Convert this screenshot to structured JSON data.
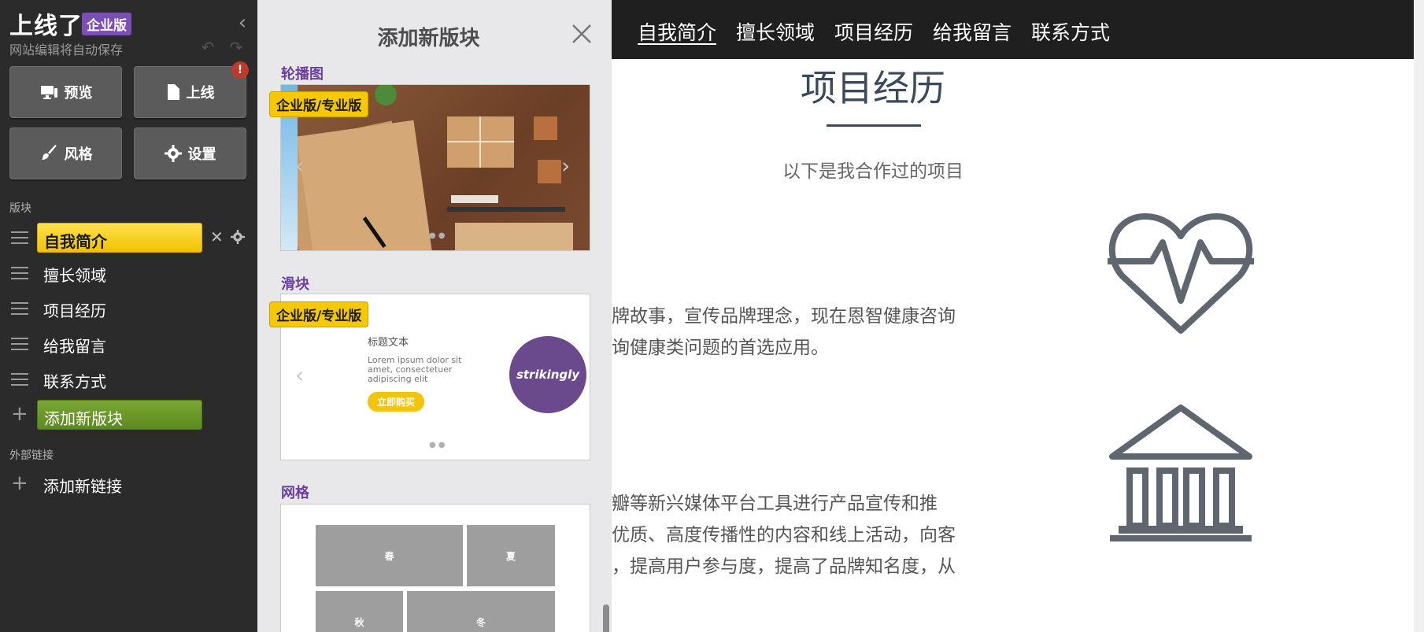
{
  "sidebar": {
    "brand": "上线了",
    "edition_badge": "企业版",
    "autosave_note": "网站编辑将自动保存",
    "alert_count": "!",
    "buttons": {
      "preview": "预览",
      "publish": "上线",
      "style": "风格",
      "settings": "设置"
    },
    "section_blocks": "版块",
    "items": [
      {
        "label": "自我简介",
        "active": true
      },
      {
        "label": "擅长领域"
      },
      {
        "label": "项目经历"
      },
      {
        "label": "给我留言"
      },
      {
        "label": "联系方式"
      }
    ],
    "add_block": "添加新版块",
    "section_links": "外部链接",
    "add_link": "添加新链接",
    "colors": {
      "bg": "#2b2b2b",
      "active": "#f5c800",
      "add": "#6a9a27"
    }
  },
  "panel": {
    "title": "添加新版块",
    "categories": [
      {
        "label": "轮播图",
        "tier": "企业版/专业版"
      },
      {
        "label": "滑块",
        "tier": "企业版/专业版"
      },
      {
        "label": "网格"
      }
    ],
    "slider_preview": {
      "heading": "标题文本",
      "body": "Lorem ipsum dolor sit amet, consectetuer adipiscing elit",
      "button": "立即购买",
      "logo": "strikingly"
    },
    "grid_preview": {
      "cells": [
        "春",
        "夏",
        "秋",
        "冬"
      ]
    }
  },
  "site": {
    "nav": [
      "自我简介",
      "擅长领域",
      "项目经历",
      "给我留言",
      "联系方式"
    ],
    "section_title": "项目经历",
    "section_subtitle": "以下是我合作过的项目",
    "projects": [
      {
        "lines": [
          "牌故事，宣传品牌理念，现在恩智健康咨询",
          "询健康类问题的首选应用。"
        ],
        "icon": "heart-pulse-icon"
      },
      {
        "lines": [
          "瓣等新兴媒体平台工具进行产品宣传和推",
          "优质、高度传播性的内容和线上活动，向客",
          "，提高用户参与度，提高了品牌知名度，从"
        ],
        "icon": "bank-building-icon"
      }
    ],
    "colors": {
      "nav_bg": "#1f1f1f",
      "heading": "#3a4a5a"
    }
  }
}
